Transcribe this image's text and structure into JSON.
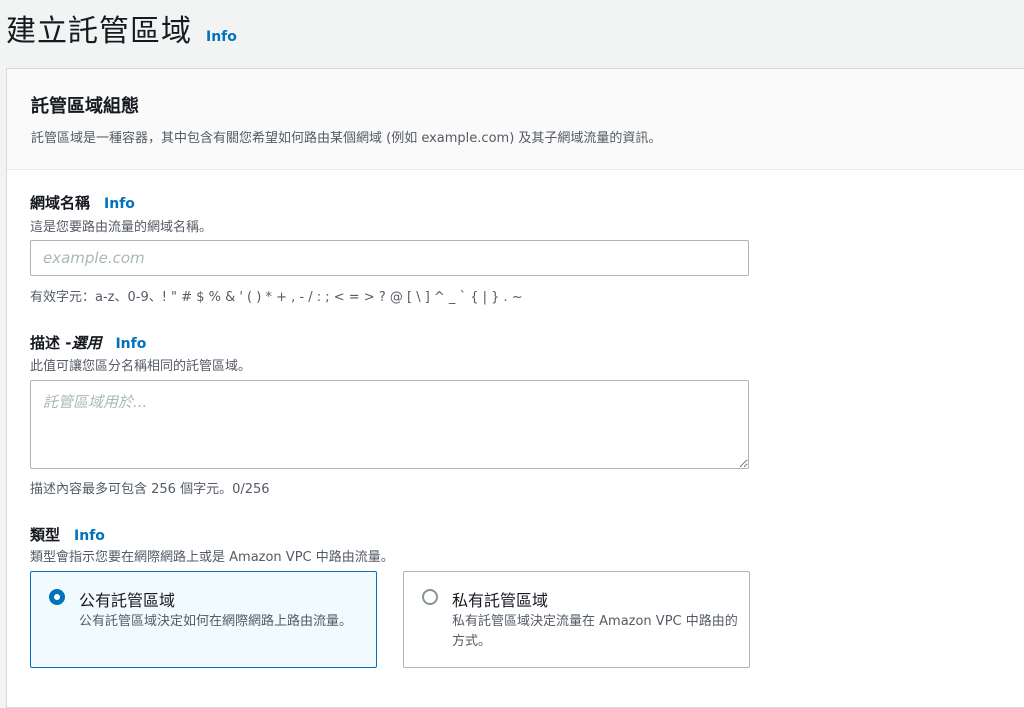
{
  "page": {
    "title": "建立託管區域",
    "info": "Info"
  },
  "config": {
    "title": "託管區域組態",
    "description": "託管區域是一種容器，其中包含有關您希望如何路由某個網域 (例如 example.com) 及其子網域流量的資訊。"
  },
  "domain": {
    "label": "網域名稱",
    "info": "Info",
    "description": "這是您要路由流量的網域名稱。",
    "placeholder": "example.com",
    "hint": "有效字元：a-z、0-9、! \" # $ % & ' ( ) * + , - / : ; < = > ? @ [ \\ ] ^ _ ` { | } . ~"
  },
  "descriptionField": {
    "label": "描述 - ",
    "optional": "選用",
    "info": "Info",
    "description": "此值可讓您區分名稱相同的託管區域。",
    "placeholder": "託管區域用於...",
    "hint": "描述內容最多可包含 256 個字元。0/256"
  },
  "type": {
    "label": "類型",
    "info": "Info",
    "description": "類型會指示您要在網際網路上或是 Amazon VPC 中路由流量。",
    "options": [
      {
        "title": "公有託管區域",
        "description": "公有託管區域決定如何在網際網路上路由流量。",
        "selected": true
      },
      {
        "title": "私有託管區域",
        "description": "私有託管區域決定流量在 Amazon VPC 中路由的方式。",
        "selected": false
      }
    ]
  },
  "colors": {
    "accent": "#0073bb",
    "background": "#f2f3f3",
    "panel": "#ffffff"
  }
}
